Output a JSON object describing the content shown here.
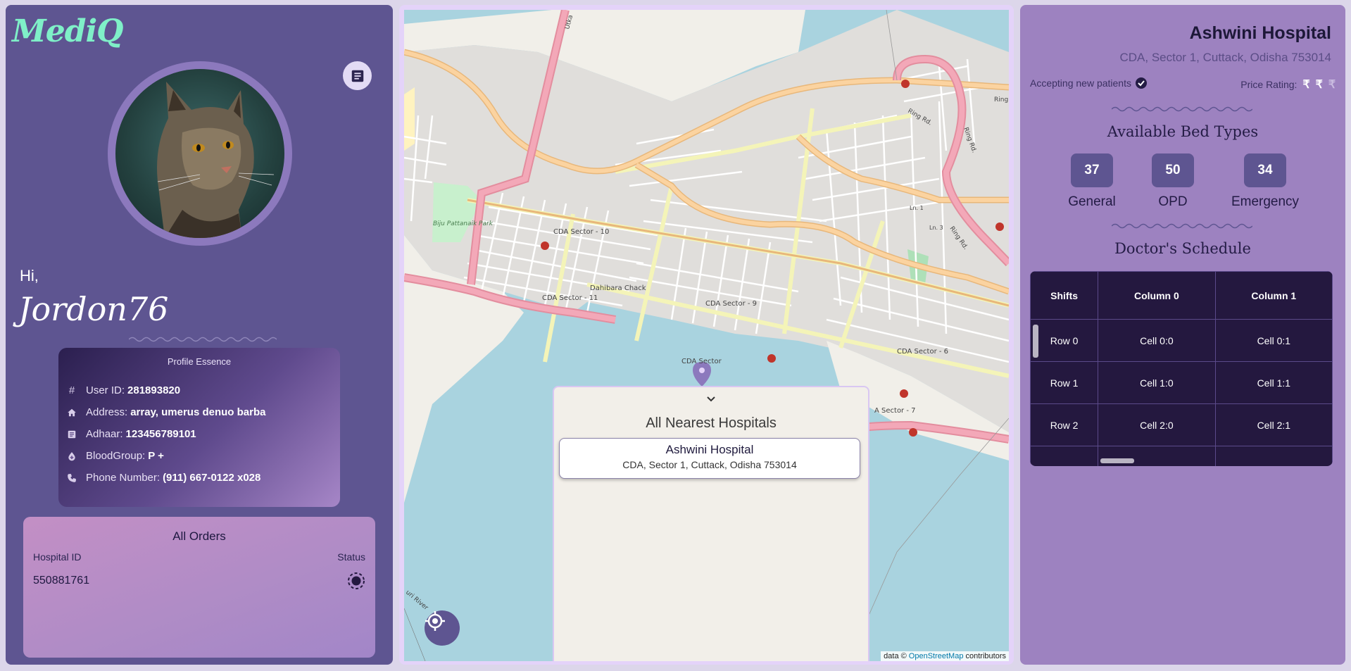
{
  "app": {
    "logo": "MediQ"
  },
  "profile": {
    "greeting": "Hi,",
    "username": "Jordon76",
    "essence_title": "Profile Essence",
    "fields": [
      {
        "label": "User ID:",
        "value": "281893820",
        "icon": "hash-icon"
      },
      {
        "label": "Address:",
        "value": "array, umerus denuo barba",
        "icon": "home-icon"
      },
      {
        "label": "Adhaar:",
        "value": "123456789101",
        "icon": "document-icon"
      },
      {
        "label": "BloodGroup:",
        "value": "P +",
        "icon": "blood-drop-icon"
      },
      {
        "label": "Phone Number:",
        "value": "(911) 667-0122 x028",
        "icon": "phone-icon"
      }
    ]
  },
  "orders": {
    "title": "All Orders",
    "col_id": "Hospital ID",
    "col_status": "Status",
    "rows": [
      {
        "id": "550881761",
        "status_icon": "pending-status-icon"
      }
    ]
  },
  "map": {
    "drawer_title": "All Nearest Hospitals",
    "hospitals": [
      {
        "name": "Ashwini Hospital",
        "address": "CDA, Sector 1, Cuttack, Odisha 753014"
      }
    ],
    "labels": [
      "CDA Sector - 10",
      "CDA Sector - 11",
      "Dahibara Chack",
      "CDA Sector - 9",
      "CDA Sector",
      "CDA Sector - 6",
      "A Sector - 7",
      "Biju Pattanaik Park",
      "Ring Rd.",
      "Ring Rd.",
      "Ring",
      "Ln. 1",
      "Ln. 3",
      "Ring Rd.",
      "Utka",
      "uri River"
    ],
    "attribution_prefix": "data ©",
    "attribution_link": "OpenStreetMap",
    "attribution_suffix": "contributors"
  },
  "hospital": {
    "name": "Ashwini Hospital",
    "address": "CDA, Sector 1, Cuttack, Odisha 753014",
    "accepting": "Accepting new patients",
    "price_label": "Price Rating:",
    "price_symbols": [
      "₹",
      "₹",
      "₹"
    ],
    "beds_title": "Available Bed Types",
    "beds": [
      {
        "count": "37",
        "label": "General"
      },
      {
        "count": "50",
        "label": "OPD"
      },
      {
        "count": "34",
        "label": "Emergency"
      }
    ],
    "schedule_title": "Doctor's Schedule",
    "schedule": {
      "headers": [
        "Shifts",
        "Column 0",
        "Column 1"
      ],
      "rows": [
        [
          "Row 0",
          "Cell 0:0",
          "Cell 0:1"
        ],
        [
          "Row 1",
          "Cell 1:0",
          "Cell 1:1"
        ],
        [
          "Row 2",
          "Cell 2:0",
          "Cell 2:1"
        ],
        [
          "",
          "",
          ""
        ]
      ]
    }
  },
  "colors": {
    "panel_left": "#5e5591",
    "panel_right": "#9d82c0",
    "logo": "#7ff0c8",
    "schedule_bg": "#24183f",
    "map_water": "#a9d3df",
    "map_land": "#e0dedb"
  }
}
